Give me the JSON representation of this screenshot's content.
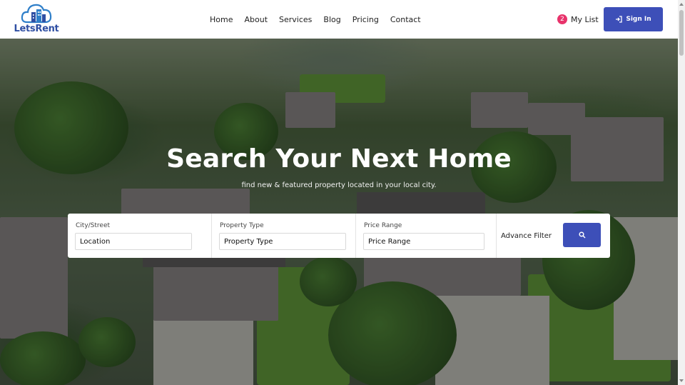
{
  "brand": {
    "name": "LetsRent",
    "logo_icon": "cloud-building-logo"
  },
  "nav": {
    "items": [
      {
        "label": "Home"
      },
      {
        "label": "About"
      },
      {
        "label": "Services"
      },
      {
        "label": "Blog"
      },
      {
        "label": "Pricing"
      },
      {
        "label": "Contact"
      }
    ]
  },
  "mylist": {
    "count": "2",
    "label": "My List"
  },
  "signin": {
    "label": "Sign In",
    "icon": "sign-in-icon"
  },
  "hero": {
    "title": "Search Your Next Home",
    "subtitle": "find new & featured property located in your local city."
  },
  "search": {
    "fields": [
      {
        "label": "City/Street",
        "value": "Location"
      },
      {
        "label": "Property Type",
        "value": "Property Type"
      },
      {
        "label": "Price Range",
        "value": "Price Range"
      }
    ],
    "advance_label": "Advance Filter",
    "button_icon": "search-icon"
  },
  "colors": {
    "accent": "#3d4fb8",
    "badge": "#e8336b",
    "brand": "#2f4fa3"
  }
}
